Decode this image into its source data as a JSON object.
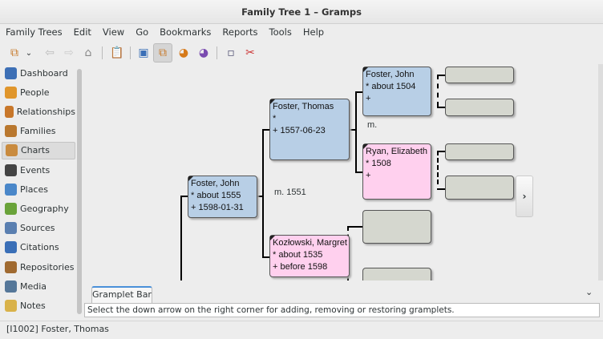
{
  "window": {
    "title": "Family Tree 1 – Gramps"
  },
  "menu": [
    "Family Trees",
    "Edit",
    "View",
    "Go",
    "Bookmarks",
    "Reports",
    "Tools",
    "Help"
  ],
  "toolbar": {
    "icons": [
      "tree-view-icon",
      "dropdown-chevron-icon",
      "back-icon",
      "forward-icon",
      "home-icon",
      "clipboard-icon",
      "configure-view-icon",
      "pedigree-icon",
      "fan-chart-icon",
      "descendant-fan-icon",
      "media-icon",
      "tool-scissors-icon"
    ]
  },
  "sidebar": {
    "items": [
      {
        "label": "Dashboard",
        "color": "#3d6fb5"
      },
      {
        "label": "People",
        "color": "#e0962c"
      },
      {
        "label": "Relationships",
        "color": "#c8772a"
      },
      {
        "label": "Families",
        "color": "#b9782f"
      },
      {
        "label": "Charts",
        "color": "#c98b3f",
        "selected": true
      },
      {
        "label": "Events",
        "color": "#444444"
      },
      {
        "label": "Places",
        "color": "#4a87c9"
      },
      {
        "label": "Geography",
        "color": "#6aa33a"
      },
      {
        "label": "Sources",
        "color": "#5a7fb0"
      },
      {
        "label": "Citations",
        "color": "#3a6fb7"
      },
      {
        "label": "Repositories",
        "color": "#a06a30"
      },
      {
        "label": "Media",
        "color": "#557799"
      },
      {
        "label": "Notes",
        "color": "#d9b24a"
      }
    ]
  },
  "pedigree": {
    "root": {
      "name": "Foster, John",
      "birth": "* about 1555",
      "death": "+ 1598-01-31"
    },
    "father": {
      "name": "Foster, Thomas",
      "birth": "*",
      "death": "+ 1557-06-23"
    },
    "mother": {
      "name": "Kozłowski, Margret",
      "birth": "* about 1535",
      "death": "+ before 1598"
    },
    "parents_marriage": "m. 1551",
    "paternal_grandfather": {
      "name": "Foster, John",
      "birth": "* about 1504",
      "death": "+"
    },
    "paternal_grandmother": {
      "name": "Ryan, Elizabeth",
      "birth": "* 1508",
      "death": "+"
    },
    "grandparents_marriage": "m.",
    "expand_label": "›"
  },
  "gramplet": {
    "tab": "Gramplet Bar",
    "chevron": "⌄",
    "message": "Select the down arrow on the right corner for adding, removing or restoring gramplets."
  },
  "status": "[I1002] Foster, Thomas"
}
